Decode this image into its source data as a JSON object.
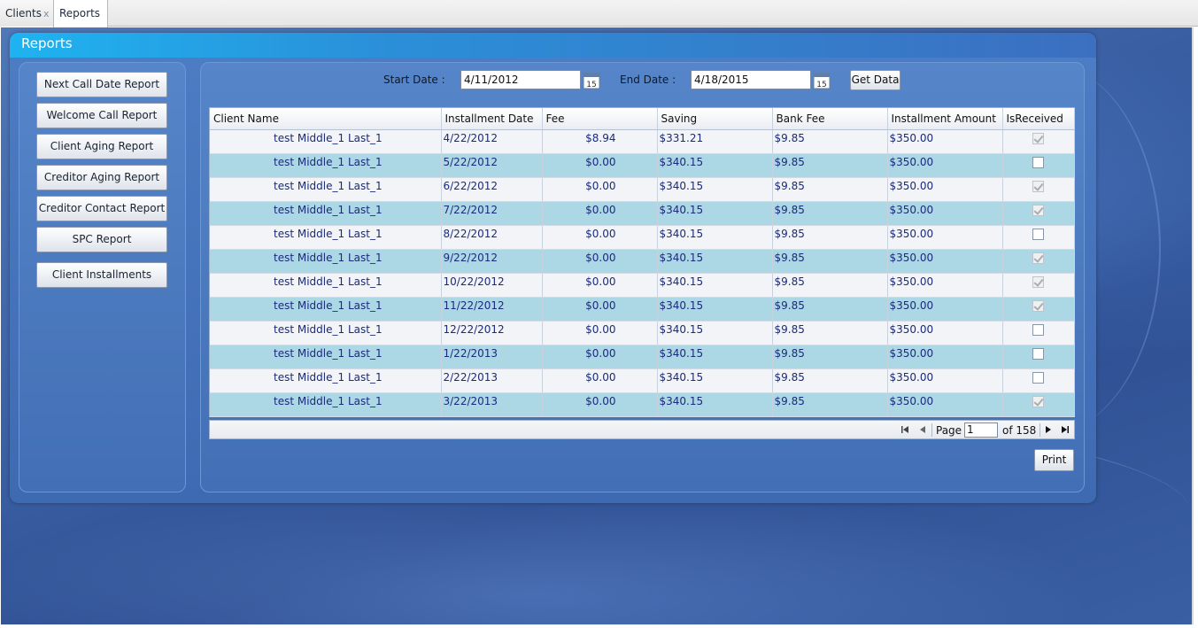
{
  "tabs": [
    {
      "label": "Clients",
      "close": "x"
    },
    {
      "label": "Reports"
    }
  ],
  "panel": {
    "title": "Reports"
  },
  "nav": {
    "items": [
      "Next Call Date Report",
      "Welcome Call Report",
      "Client Aging Report",
      "Creditor Aging Report",
      "Creditor Contact Report",
      "SPC Report",
      "Client Installments"
    ]
  },
  "filters": {
    "start_label": "Start Date :",
    "start_value": "4/11/2012",
    "end_label": "End Date :",
    "end_value": "4/18/2015",
    "calendar_day": "15",
    "get_data": "Get Data"
  },
  "grid": {
    "columns": [
      "Client Name",
      "Installment Date",
      "Fee",
      "Saving",
      "Bank Fee",
      "Installment Amount",
      "IsReceived"
    ],
    "rows": [
      {
        "name": "test Middle_1 Last_1",
        "date": "4/22/2012",
        "fee": "$8.94",
        "saving": "$331.21",
        "bank_fee": "$9.85",
        "amount": "$350.00",
        "received": true
      },
      {
        "name": "test Middle_1 Last_1",
        "date": "5/22/2012",
        "fee": "$0.00",
        "saving": "$340.15",
        "bank_fee": "$9.85",
        "amount": "$350.00",
        "received": false
      },
      {
        "name": "test Middle_1 Last_1",
        "date": "6/22/2012",
        "fee": "$0.00",
        "saving": "$340.15",
        "bank_fee": "$9.85",
        "amount": "$350.00",
        "received": true
      },
      {
        "name": "test Middle_1 Last_1",
        "date": "7/22/2012",
        "fee": "$0.00",
        "saving": "$340.15",
        "bank_fee": "$9.85",
        "amount": "$350.00",
        "received": true
      },
      {
        "name": "test Middle_1 Last_1",
        "date": "8/22/2012",
        "fee": "$0.00",
        "saving": "$340.15",
        "bank_fee": "$9.85",
        "amount": "$350.00",
        "received": false
      },
      {
        "name": "test Middle_1 Last_1",
        "date": "9/22/2012",
        "fee": "$0.00",
        "saving": "$340.15",
        "bank_fee": "$9.85",
        "amount": "$350.00",
        "received": true
      },
      {
        "name": "test Middle_1 Last_1",
        "date": "10/22/2012",
        "fee": "$0.00",
        "saving": "$340.15",
        "bank_fee": "$9.85",
        "amount": "$350.00",
        "received": true
      },
      {
        "name": "test Middle_1 Last_1",
        "date": "11/22/2012",
        "fee": "$0.00",
        "saving": "$340.15",
        "bank_fee": "$9.85",
        "amount": "$350.00",
        "received": true
      },
      {
        "name": "test Middle_1 Last_1",
        "date": "12/22/2012",
        "fee": "$0.00",
        "saving": "$340.15",
        "bank_fee": "$9.85",
        "amount": "$350.00",
        "received": false
      },
      {
        "name": "test Middle_1 Last_1",
        "date": "1/22/2013",
        "fee": "$0.00",
        "saving": "$340.15",
        "bank_fee": "$9.85",
        "amount": "$350.00",
        "received": false
      },
      {
        "name": "test Middle_1 Last_1",
        "date": "2/22/2013",
        "fee": "$0.00",
        "saving": "$340.15",
        "bank_fee": "$9.85",
        "amount": "$350.00",
        "received": false
      },
      {
        "name": "test Middle_1 Last_1",
        "date": "3/22/2013",
        "fee": "$0.00",
        "saving": "$340.15",
        "bank_fee": "$9.85",
        "amount": "$350.00",
        "received": true
      }
    ]
  },
  "pager": {
    "page_label": "Page",
    "page_value": "1",
    "of_label": "of 158"
  },
  "print_label": "Print",
  "icons": {
    "calendar": "calendar-icon",
    "first": "first-page-icon",
    "prev": "previous-page-icon",
    "next": "next-page-icon",
    "last": "last-page-icon"
  }
}
